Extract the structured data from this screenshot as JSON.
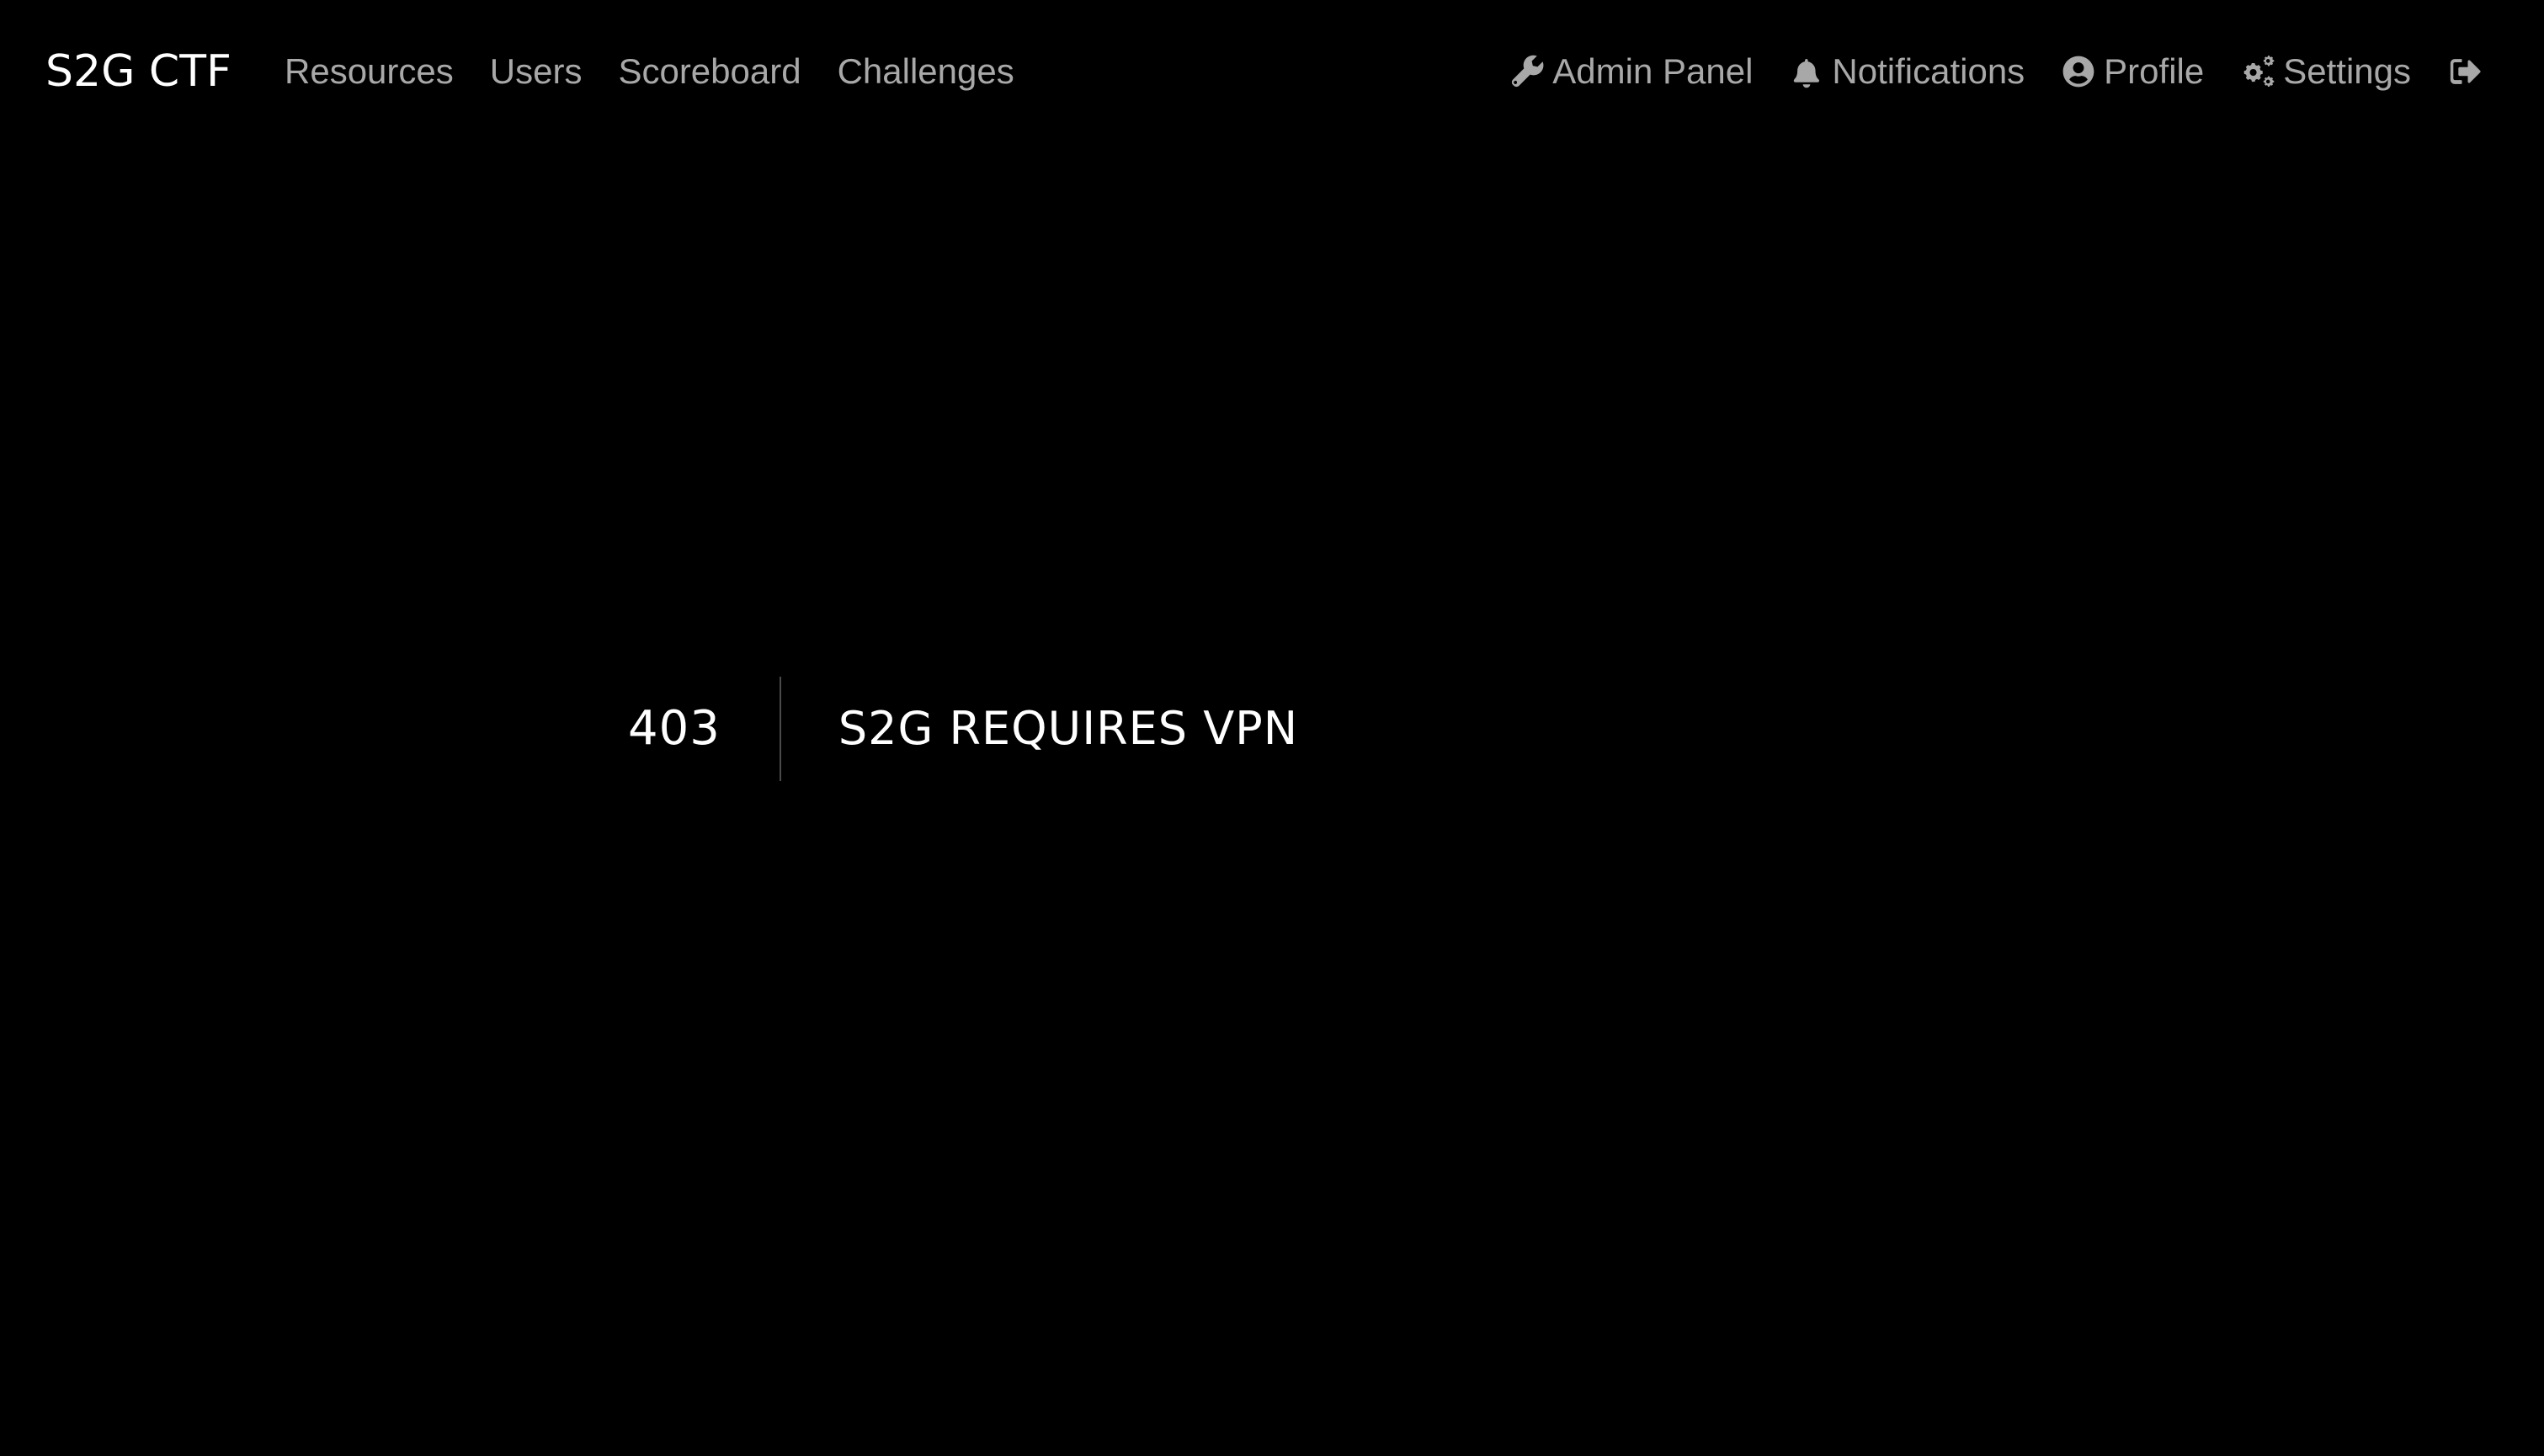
{
  "navbar": {
    "brand": "S2G CTF",
    "left_links": [
      {
        "label": "Resources"
      },
      {
        "label": "Users"
      },
      {
        "label": "Scoreboard"
      },
      {
        "label": "Challenges"
      }
    ],
    "right_links": [
      {
        "label": "Admin Panel",
        "icon": "wrench-icon"
      },
      {
        "label": "Notifications",
        "icon": "bell-icon"
      },
      {
        "label": "Profile",
        "icon": "user-circle-icon"
      },
      {
        "label": "Settings",
        "icon": "gears-icon"
      },
      {
        "label": "",
        "icon": "logout-icon"
      }
    ]
  },
  "error": {
    "code": "403",
    "message": "S2G REQUIRES VPN"
  },
  "colors": {
    "background": "#000000",
    "brand_text": "#ffffff",
    "nav_text": "#a8a8a8",
    "divider": "#4a4a4a"
  }
}
